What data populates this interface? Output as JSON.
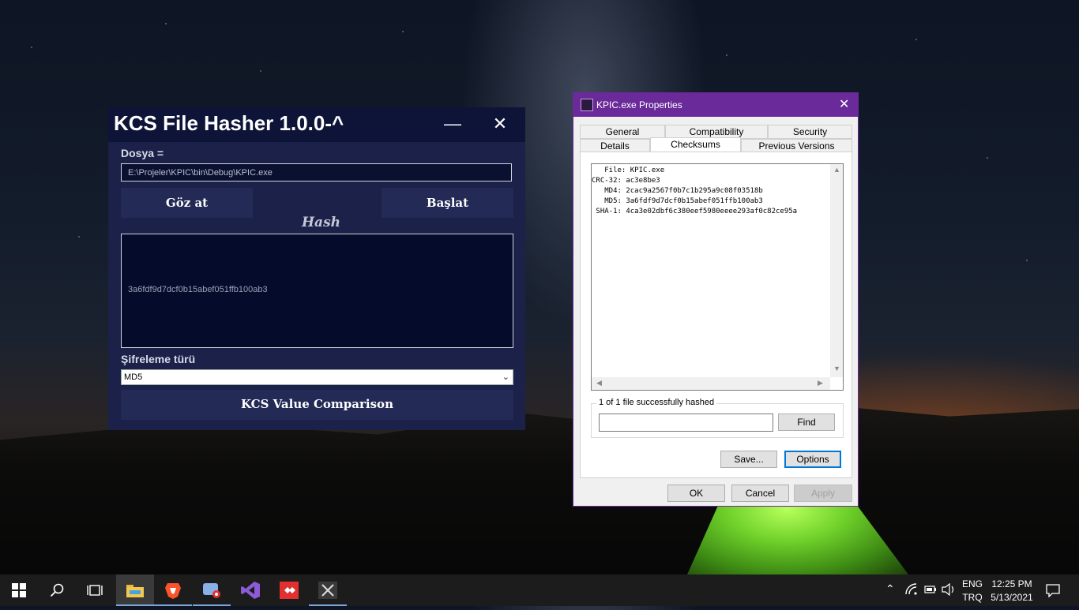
{
  "kcs": {
    "title": "KCS File Hasher 1.0.0-^",
    "minimize_glyph": "—",
    "close_glyph": "✕",
    "file_label": "Dosya =",
    "file_path": "E:\\Projeler\\KPIC\\bin\\Debug\\KPIC.exe",
    "browse_label": "Göz at",
    "start_label": "Başlat",
    "hash_label": "Hash",
    "hash_value": "3a6fdf9d7dcf0b15abef051ffb100ab3",
    "encryption_label": "Şifreleme türü",
    "encryption_selected": "MD5",
    "compare_label": "KCS Value Comparison",
    "colors": {
      "title_bg": "#0e1438",
      "body_bg": "#1b2148",
      "button_bg": "#232a55",
      "hash_bg": "#050b2a"
    }
  },
  "props": {
    "title": "KPIC.exe Properties",
    "close_glyph": "✕",
    "tabs_row1": [
      "General",
      "Compatibility",
      "Security"
    ],
    "tabs_row2": [
      "Details",
      "Checksums",
      "Previous Versions"
    ],
    "selected_tab": "Checksums",
    "checksum_lines": [
      "   File: KPIC.exe",
      "CRC-32: ac3e8be3",
      "   MD4: 2cac9a2567f0b7c1b295a9c08f03518b",
      "   MD5: 3a6fdf9d7dcf0b15abef051ffb100ab3",
      " SHA-1: 4ca3e02dbf6c380eef5980eeee293af0c82ce95a"
    ],
    "status_text": "1 of 1 file successfully hashed",
    "find_label": "Find",
    "save_label": "Save...",
    "options_label": "Options",
    "ok_label": "OK",
    "cancel_label": "Cancel",
    "apply_label": "Apply",
    "accent": "#6a2a9a"
  },
  "taskbar": {
    "icons": [
      "windows-start-icon",
      "search-icon",
      "task-view-icon",
      "file-explorer-icon",
      "brave-browser-icon",
      "app-recorder-icon",
      "visual-studio-icon",
      "anydesk-icon",
      "tools-icon"
    ],
    "lang_top": "ENG",
    "lang_bottom": "TRQ",
    "time": "12:25 PM",
    "date": "5/13/2021"
  }
}
